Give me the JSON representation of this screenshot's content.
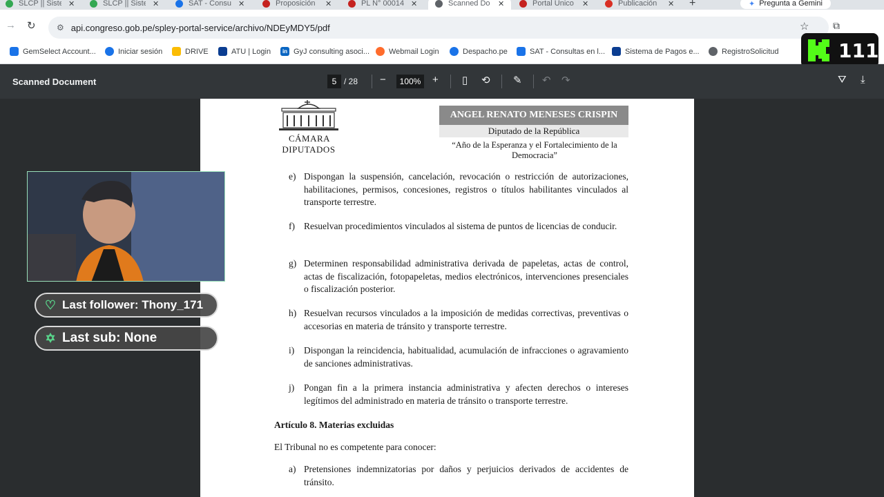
{
  "browser": {
    "tabs": [
      {
        "title": "SLCP || Sistem",
        "favicon_color": "#34a853",
        "active": false
      },
      {
        "title": "SLCP || Sistem",
        "favicon_color": "#34a853",
        "active": false
      },
      {
        "title": "SAT - Consulta",
        "favicon_color": "#1a73e8",
        "active": false
      },
      {
        "title": "Proposición",
        "favicon_color": "#c5221f",
        "active": false
      },
      {
        "title": "PL N° 00014",
        "favicon_color": "#c5221f",
        "active": false
      },
      {
        "title": "Scanned Do",
        "favicon_color": "#5f6368",
        "active": true
      },
      {
        "title": "Portal Único",
        "favicon_color": "#c5221f",
        "active": false
      },
      {
        "title": "Publicación",
        "favicon_color": "#d93025",
        "active": false
      }
    ],
    "new_tab_symbol": "+",
    "gemini_label": "Pregunta a Gemini",
    "url": "api.congreso.gob.pe/spley-portal-service/archivo/NDEyMDY5/pdf"
  },
  "bookmarks": [
    {
      "label": "GemSelect Account...",
      "icon": "wrench-icon",
      "color": "#1a73e8"
    },
    {
      "label": "Iniciar sesión",
      "icon": "globe-icon",
      "color": "#1a73e8"
    },
    {
      "label": "DRIVE",
      "icon": "drive-icon",
      "color": "#fbbc04"
    },
    {
      "label": "ATU | Login",
      "icon": "atu-logo-icon",
      "color": "#0b3d91"
    },
    {
      "label": "GyJ consulting asoci...",
      "icon": "linkedin-icon",
      "color": "#0a66c2"
    },
    {
      "label": "Webmail Login",
      "icon": "cpanel-icon",
      "color": "#ff6c2c"
    },
    {
      "label": "Despacho.pe",
      "icon": "globe-icon",
      "color": "#1a73e8"
    },
    {
      "label": "SAT - Consultas en l...",
      "icon": "sat-icon",
      "color": "#1a73e8"
    },
    {
      "label": "Sistema de Pagos e...",
      "icon": "atu-logo-icon",
      "color": "#0b3d91"
    },
    {
      "label": "RegistroSolicitud",
      "icon": "globe-icon",
      "color": "#5f6368"
    }
  ],
  "kick": {
    "count": "111"
  },
  "pdf": {
    "title": "Scanned Document",
    "current_page": "5",
    "total_pages": "/ 28",
    "zoom": "100%"
  },
  "document": {
    "org_line1": "CÁMARA",
    "org_line2": "DIPUTADOS",
    "name": "ANGEL RENATO MENESES CRISPIN",
    "role": "Diputado de la República",
    "motto": "“Año de la Esperanza y el Fortalecimiento de la Democracia”",
    "items": [
      {
        "letter": "e)",
        "text": "Dispongan la suspensión, cancelación, revocación o restricción de autorizaciones, habilitaciones, permisos, concesiones, registros o títulos habilitantes vinculados al transporte terrestre."
      },
      {
        "letter": "f)",
        "text": "Resuelvan procedimientos vinculados al sistema de puntos de licencias de conducir."
      },
      {
        "letter": "g)",
        "text": "Determinen responsabilidad administrativa derivada de papeletas, actas de control, actas de fiscalización, fotopapeletas, medios electrónicos, intervenciones presenciales o fiscalización posterior."
      },
      {
        "letter": "h)",
        "text": "Resuelvan recursos vinculados a la imposición de medidas correctivas, preventivas o accesorias en materia de tránsito y transporte terrestre."
      },
      {
        "letter": "i)",
        "text": "Dispongan la reincidencia, habitualidad, acumulación de infracciones o agravamiento de sanciones administrativas."
      },
      {
        "letter": "j)",
        "text": "Pongan fin a la primera instancia administrativa y afecten derechos o intereses legítimos del administrado en materia de tránsito o transporte terrestre."
      }
    ],
    "article_title": "Artículo 8. Materias excluidas",
    "article_intro": "El Tribunal no es competente para conocer:",
    "excluded": [
      {
        "letter": "a)",
        "text": "Pretensiones indemnizatorias por daños y perjuicios derivados de accidentes de tránsito."
      }
    ]
  },
  "stream": {
    "last_follower": "Last follower: Thony_171",
    "last_sub": "Last sub: None"
  }
}
